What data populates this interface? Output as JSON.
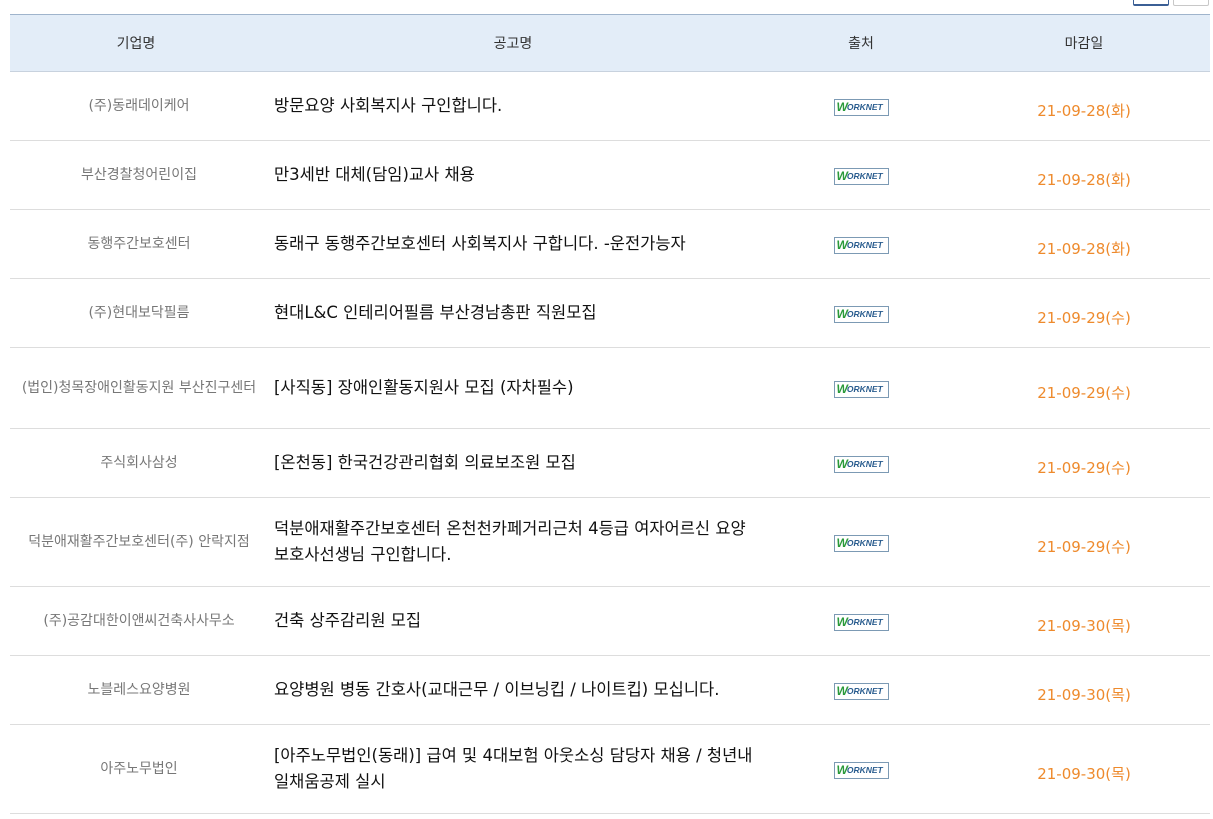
{
  "header": {
    "company": "기업명",
    "title": "공고명",
    "source": "출처",
    "deadline": "마감일"
  },
  "source_logo": {
    "w": "W",
    "rest": "ORKNET",
    "name": "WORKNET"
  },
  "colors": {
    "header_bg": "#e3edf8",
    "deadline": "#ee8a2c",
    "company_text": "#777777",
    "logo_green": "#2b9a3b",
    "logo_blue": "#2a5d8f"
  },
  "rows": [
    {
      "company": "(주)동래데이케어",
      "title": "방문요양 사회복지사 구인합니다.",
      "deadline": "21-09-28(화)"
    },
    {
      "company": "부산경찰청어린이집",
      "title": "만3세반 대체(담임)교사 채용",
      "deadline": "21-09-28(화)"
    },
    {
      "company": "동행주간보호센터",
      "title": "동래구 동행주간보호센터 사회복지사 구합니다. -운전가능자",
      "deadline": "21-09-28(화)"
    },
    {
      "company": "(주)현대보닥필름",
      "title": "현대L&C 인테리어필름 부산경남총판 직원모집",
      "deadline": "21-09-29(수)"
    },
    {
      "company": "(법인)청목장애인활동지원 부산진구센터",
      "title": "[사직동] 장애인활동지원사 모집 (자차필수)",
      "deadline": "21-09-29(수)"
    },
    {
      "company": "주식회사삼성",
      "title": "[온천동] 한국건강관리협회 의료보조원 모집",
      "deadline": "21-09-29(수)"
    },
    {
      "company": "덕분애재활주간보호센터(주) 안락지점",
      "title": "덕분애재활주간보호센터 온천천카페거리근처 4등급 여자어르신 요양보호사선생님 구인합니다.",
      "deadline": "21-09-29(수)"
    },
    {
      "company": "(주)공감대한이앤씨건축사사무소",
      "title": "건축 상주감리원 모집",
      "deadline": "21-09-30(목)"
    },
    {
      "company": "노블레스요양병원",
      "title": "요양병원 병동 간호사(교대근무 / 이브닝킵 / 나이트킵) 모십니다.",
      "deadline": "21-09-30(목)"
    },
    {
      "company": "아주노무법인",
      "title": "[아주노무법인(동래)] 급여 및 4대보험 아웃소싱 담당자 채용 / 청년내일채움공제 실시",
      "deadline": "21-09-30(목)"
    }
  ]
}
